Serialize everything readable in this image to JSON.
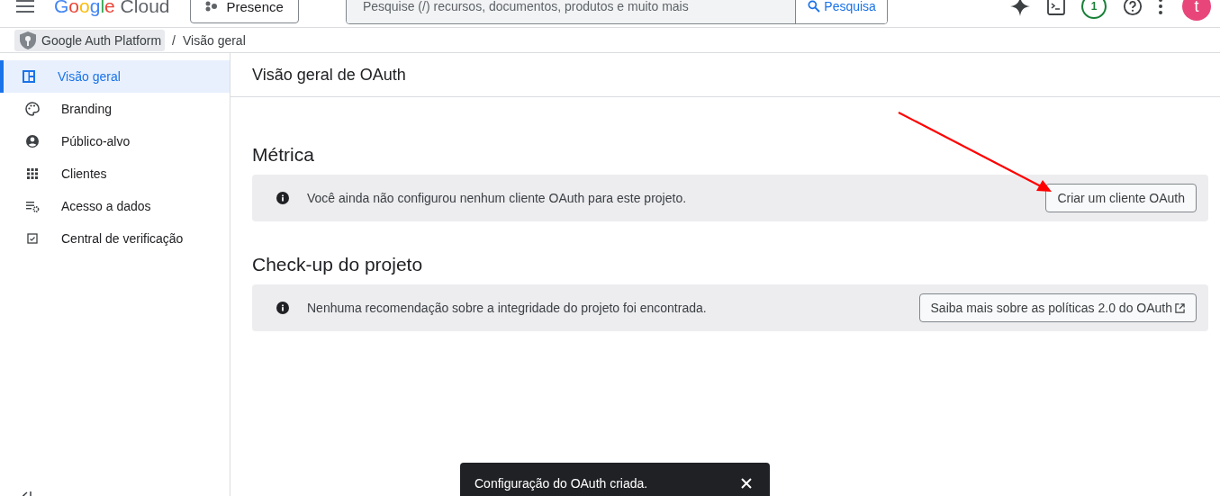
{
  "header": {
    "logo": "Google Cloud",
    "project": "Presence",
    "search": {
      "placeholder": "Pesquise (/) recursos, documentos, produtos e muito mais"
    },
    "search_button": "Pesquisa",
    "notifications_badge": "1",
    "avatar": "t"
  },
  "breadcrumb": {
    "product": "Google Auth Platform",
    "separator": "/",
    "page": "Visão geral"
  },
  "sidebar": {
    "items": [
      {
        "label": "Visão geral",
        "kind": "dashboard",
        "selected": true
      },
      {
        "label": "Branding",
        "kind": "palette",
        "selected": false
      },
      {
        "label": "Público-alvo",
        "kind": "person",
        "selected": false
      },
      {
        "label": "Clientes",
        "kind": "grid",
        "selected": false
      },
      {
        "label": "Acesso a dados",
        "kind": "settings",
        "selected": false
      },
      {
        "label": "Central de verificação",
        "kind": "checklist",
        "selected": false
      }
    ]
  },
  "page": {
    "title": "Visão geral de OAuth",
    "sections": [
      {
        "heading": "Métrica",
        "message": "Você ainda não configurou nenhum cliente OAuth para este projeto.",
        "action": "Criar um cliente OAuth",
        "external": false
      },
      {
        "heading": "Check-up do projeto",
        "message": "Nenhuma recomendação sobre a integridade do projeto foi encontrada.",
        "action": "Saiba mais sobre as políticas 2.0 do OAuth",
        "external": true
      }
    ]
  },
  "snackbar": {
    "message": "Configuração do OAuth criada."
  }
}
